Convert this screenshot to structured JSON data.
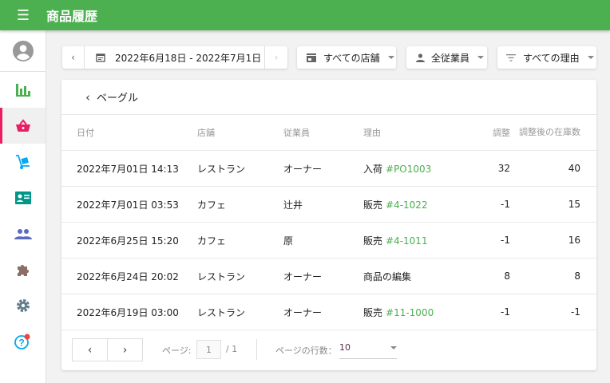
{
  "header": {
    "title": "商品履歴",
    "menu_icon": "menu-icon"
  },
  "sidebar": {
    "items": [
      {
        "name": "reports",
        "icon": "bar-chart-icon",
        "color": "#4caf50"
      },
      {
        "name": "items",
        "icon": "basket-icon",
        "color": "#e91e63",
        "selected": true
      },
      {
        "name": "inventory",
        "icon": "hand-truck-icon",
        "color": "#03a9f4"
      },
      {
        "name": "customers",
        "icon": "id-card-icon",
        "color": "#009688"
      },
      {
        "name": "employees",
        "icon": "people-icon",
        "color": "#5c6bc0"
      },
      {
        "name": "integrations",
        "icon": "puzzle-icon",
        "color": "#8d6e63"
      },
      {
        "name": "settings",
        "icon": "gear-icon",
        "color": "#607d8b"
      },
      {
        "name": "help",
        "icon": "help-icon",
        "color": "#03a9f4",
        "badge": true
      }
    ]
  },
  "toolbar": {
    "date_range": "2022年6月18日 - 2022年7月1日",
    "store": "すべての店舗",
    "employee": "全従業員",
    "reason": "すべての理由"
  },
  "card": {
    "back_label": "ベーグル",
    "columns": [
      "日付",
      "店舗",
      "従業員",
      "理由",
      "調整",
      "調整後の在庫数"
    ],
    "rows": [
      {
        "date": "2022年7月01日 14:13",
        "store": "レストラン",
        "employee": "オーナー",
        "reason": "入荷",
        "ref": "#PO1003",
        "adjust": "32",
        "after": "40"
      },
      {
        "date": "2022年7月01日 03:53",
        "store": "カフェ",
        "employee": "辻井",
        "reason": "販売",
        "ref": "#4-1022",
        "adjust": "-1",
        "after": "15"
      },
      {
        "date": "2022年6月25日 15:20",
        "store": "カフェ",
        "employee": "原",
        "reason": "販売",
        "ref": "#4-1011",
        "adjust": "-1",
        "after": "16"
      },
      {
        "date": "2022年6月24日 20:02",
        "store": "レストラン",
        "employee": "オーナー",
        "reason": "商品の編集",
        "ref": "",
        "adjust": "8",
        "after": "8"
      },
      {
        "date": "2022年6月19日 03:00",
        "store": "レストラン",
        "employee": "オーナー",
        "reason": "販売",
        "ref": "#11-1000",
        "adjust": "-1",
        "after": "-1"
      }
    ]
  },
  "pagination": {
    "page_label": "ページ:",
    "page": "1",
    "total": "/ 1",
    "rows_label": "ページの行数：",
    "rows_per_page": "10"
  }
}
